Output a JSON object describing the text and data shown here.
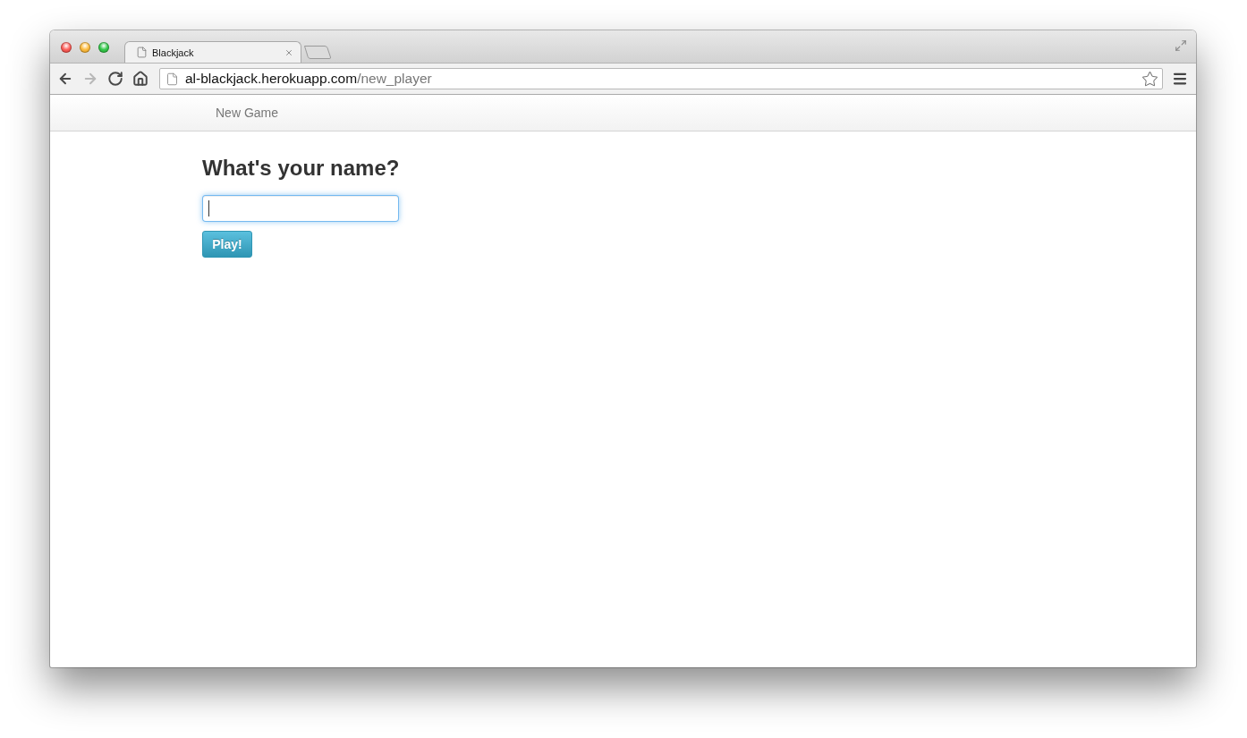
{
  "browser": {
    "tabs": [
      {
        "title": "Blackjack",
        "selected": true
      }
    ],
    "toolbar": [
      {
        "kind": "back",
        "disabled": false
      },
      {
        "kind": "forward",
        "disabled": true
      },
      {
        "kind": "reload",
        "disabled": false
      },
      {
        "kind": "home",
        "disabled": false
      }
    ],
    "address": {
      "host": "al-blackjack.herokuapp.com",
      "path": "/new_player"
    }
  },
  "navbar": {
    "links": [
      {
        "label": "New Game"
      }
    ]
  },
  "form": {
    "heading": "What's your name?",
    "name_field": {
      "focused": true
    },
    "submit": "Play!"
  }
}
